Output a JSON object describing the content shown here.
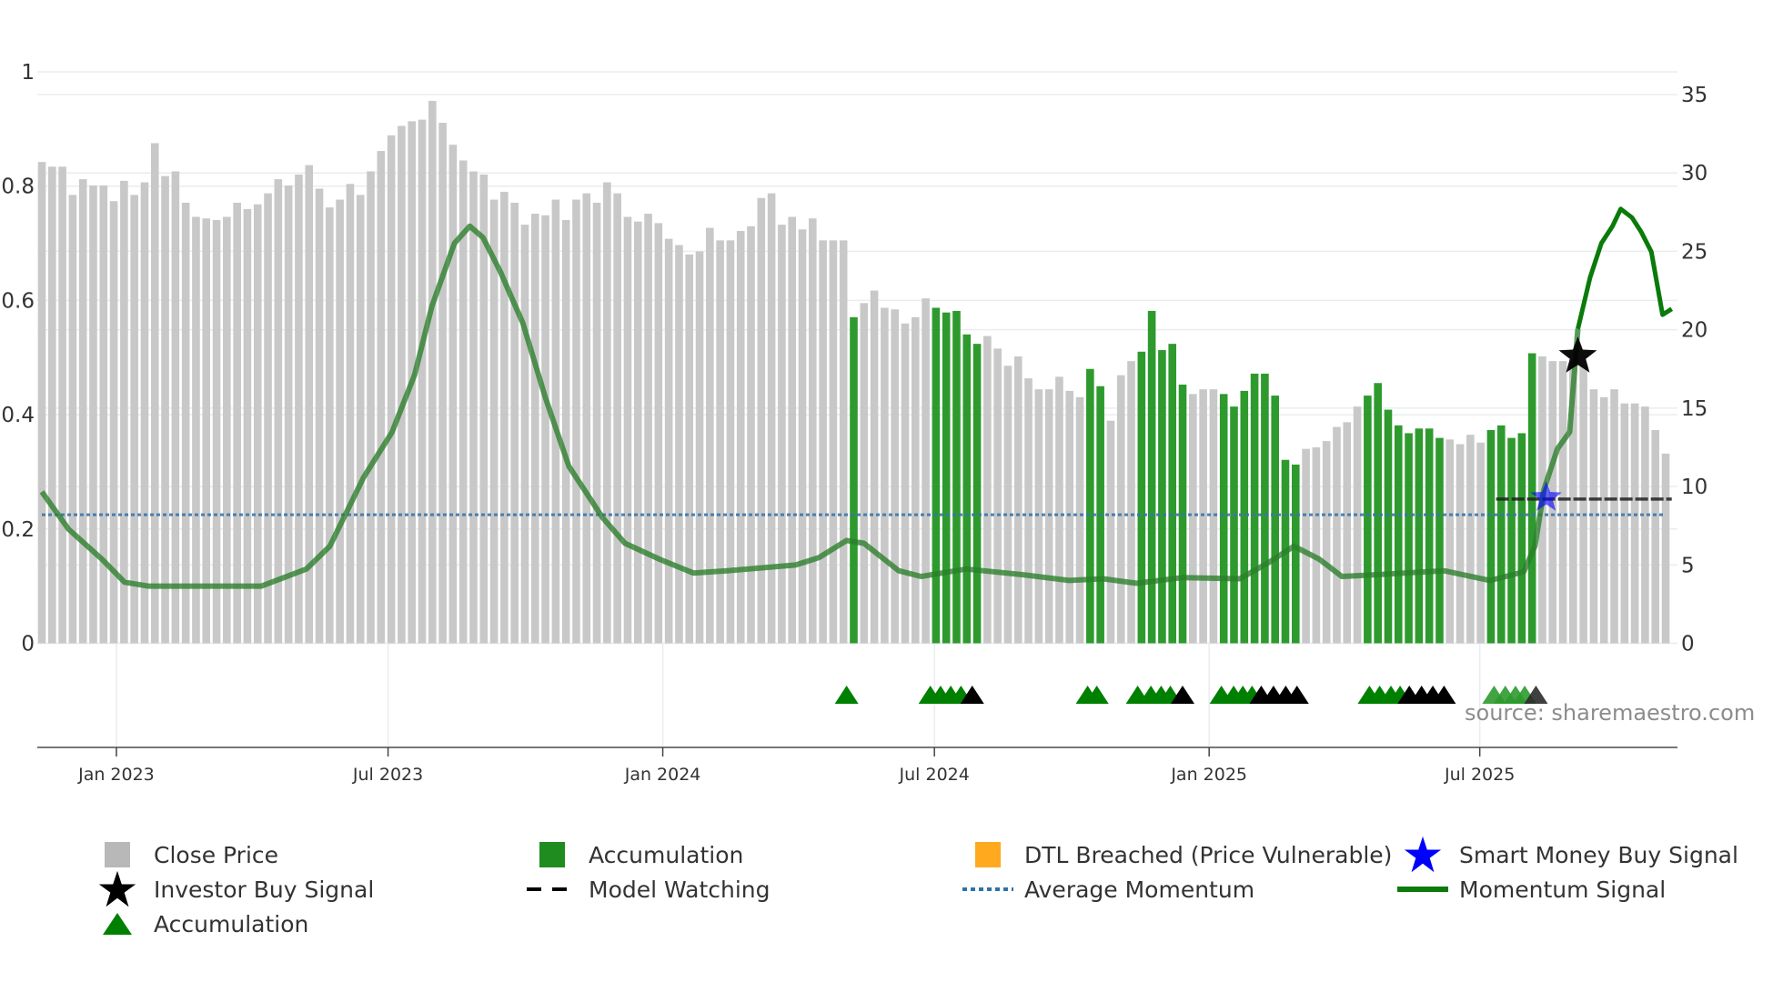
{
  "chart_data": {
    "type": "bar",
    "title": "",
    "source_text": "source: sharemaestro.com",
    "x_domain": [
      0,
      159
    ],
    "x_ticks": [
      {
        "x": 7.3,
        "label": "Jan 2023"
      },
      {
        "x": 33.9,
        "label": "Jul 2023"
      },
      {
        "x": 60.8,
        "label": "Jan 2024"
      },
      {
        "x": 87.4,
        "label": "Jul 2024"
      },
      {
        "x": 114.3,
        "label": "Jan 2025"
      },
      {
        "x": 140.8,
        "label": "Jul 2025"
      }
    ],
    "y_left": {
      "range": [
        0,
        1
      ],
      "ticks": [
        0,
        0.2,
        0.4,
        0.6,
        0.8,
        1
      ],
      "tick_labels": [
        "0",
        "0.2",
        "0.4",
        "0.6",
        "0.8",
        "1"
      ]
    },
    "y_right": {
      "range": [
        0,
        36.45
      ],
      "ticks": [
        0,
        5,
        10,
        15,
        20,
        25,
        30,
        35
      ],
      "tick_labels": [
        "0",
        "5",
        "10",
        "15",
        "20",
        "25",
        "30",
        "35"
      ]
    },
    "close_price": [
      30.7,
      30.4,
      30.4,
      28.6,
      29.6,
      29.2,
      29.2,
      28.2,
      29.5,
      28.6,
      29.4,
      31.9,
      29.8,
      30.1,
      28.1,
      27.2,
      27.1,
      27.0,
      27.2,
      28.1,
      27.7,
      28.0,
      28.7,
      29.6,
      29.2,
      29.9,
      30.5,
      29.0,
      27.8,
      28.3,
      29.3,
      28.6,
      30.1,
      31.4,
      32.4,
      33.0,
      33.3,
      33.4,
      34.6,
      33.2,
      31.8,
      30.8,
      30.1,
      29.9,
      28.3,
      28.8,
      28.1,
      26.7,
      27.4,
      27.3,
      28.3,
      27.0,
      28.3,
      28.7,
      28.1,
      29.4,
      28.7,
      27.2,
      26.9,
      27.4,
      26.8,
      25.8,
      25.4,
      24.8,
      25.0,
      26.5,
      25.7,
      25.7,
      26.3,
      26.6,
      28.4,
      28.7,
      26.7,
      27.2,
      26.4,
      27.1,
      25.7,
      25.7,
      25.7,
      20.8,
      21.7,
      22.5,
      21.4,
      21.3,
      20.4,
      20.8,
      22.0,
      21.4,
      21.1,
      21.2,
      19.7,
      19.1,
      19.6,
      18.8,
      17.7,
      18.3,
      16.9,
      16.2,
      16.2,
      17.0,
      16.1,
      15.7,
      17.5,
      16.4,
      14.2,
      17.1,
      18.0,
      18.6,
      21.2,
      18.7,
      19.1,
      16.5,
      15.9,
      16.2,
      16.2,
      15.9,
      15.1,
      16.1,
      17.2,
      17.2,
      15.8,
      11.7,
      11.4,
      12.4,
      12.5,
      12.9,
      13.8,
      14.1,
      15.1,
      15.8,
      16.6,
      14.9,
      13.9,
      13.4,
      13.7,
      13.7,
      13.1,
      13.0,
      12.7,
      13.3,
      12.8,
      13.6,
      13.9,
      13.1,
      13.4,
      18.5,
      18.3,
      18.0,
      18.0,
      18.0,
      17.7,
      16.2,
      15.7,
      16.2,
      15.3,
      15.3,
      15.1,
      13.6,
      12.1
    ],
    "accumulation_bar_indices": [
      79,
      87,
      88,
      89,
      90,
      91,
      102,
      103,
      107,
      108,
      109,
      110,
      111,
      115,
      116,
      117,
      118,
      119,
      120,
      121,
      122,
      129,
      130,
      131,
      132,
      133,
      134,
      135,
      136,
      141,
      142,
      143,
      144,
      145
    ],
    "momentum_signal": [
      [
        0,
        0.265
      ],
      [
        2.6,
        0.2
      ],
      [
        5.9,
        0.147
      ],
      [
        8.1,
        0.107
      ],
      [
        10.4,
        0.1
      ],
      [
        21.5,
        0.1
      ],
      [
        25.9,
        0.13
      ],
      [
        28.2,
        0.17
      ],
      [
        31.5,
        0.29
      ],
      [
        34.3,
        0.37
      ],
      [
        36.5,
        0.47
      ],
      [
        38.2,
        0.59
      ],
      [
        40.4,
        0.7
      ],
      [
        41.9,
        0.73
      ],
      [
        43.2,
        0.71
      ],
      [
        44.9,
        0.65
      ],
      [
        47.1,
        0.56
      ],
      [
        49.3,
        0.43
      ],
      [
        51.6,
        0.31
      ],
      [
        54.9,
        0.22
      ],
      [
        57.1,
        0.175
      ],
      [
        60.5,
        0.147
      ],
      [
        63.8,
        0.123
      ],
      [
        67.1,
        0.127
      ],
      [
        73.8,
        0.137
      ],
      [
        76.1,
        0.15
      ],
      [
        78.8,
        0.18
      ],
      [
        80.5,
        0.175
      ],
      [
        83.9,
        0.127
      ],
      [
        86.1,
        0.117
      ],
      [
        90.5,
        0.13
      ],
      [
        96.1,
        0.12
      ],
      [
        100.6,
        0.11
      ],
      [
        103.9,
        0.113
      ],
      [
        107.2,
        0.105
      ],
      [
        111.7,
        0.115
      ],
      [
        117.3,
        0.113
      ],
      [
        120,
        0.14
      ],
      [
        122.6,
        0.17
      ],
      [
        125.1,
        0.147
      ],
      [
        127.3,
        0.117
      ],
      [
        130.6,
        0.12
      ],
      [
        137.3,
        0.127
      ],
      [
        141.8,
        0.11
      ],
      [
        145.1,
        0.125
      ],
      [
        146.2,
        0.17
      ],
      [
        147.1,
        0.27
      ],
      [
        148.4,
        0.34
      ],
      [
        149.6,
        0.37
      ],
      [
        150.4,
        0.55
      ]
    ],
    "momentum_signal_recent": [
      [
        150.4,
        0.55
      ],
      [
        151.6,
        0.64
      ],
      [
        152.7,
        0.7
      ],
      [
        153.8,
        0.73
      ],
      [
        154.6,
        0.76
      ],
      [
        155.7,
        0.745
      ],
      [
        156.6,
        0.72
      ],
      [
        157.6,
        0.685
      ],
      [
        158.7,
        0.575
      ],
      [
        159.6,
        0.585
      ]
    ],
    "average_momentum": 0.225,
    "model_watching": {
      "x_start": 142.4,
      "x_end": 159.6,
      "price": 9.2
    },
    "smart_money_buy_signal": {
      "x": 147.3,
      "price": 9.3
    },
    "investor_buy_signal": {
      "x": 150.4,
      "price": 18.3
    },
    "accumulation_markers": [
      {
        "x": 78.8,
        "type": "accumulation"
      },
      {
        "x": 87.0,
        "type": "accumulation"
      },
      {
        "x": 88.0,
        "type": "accumulation"
      },
      {
        "x": 89.0,
        "type": "accumulation"
      },
      {
        "x": 90.0,
        "type": "accumulation"
      },
      {
        "x": 91.1,
        "type": "other"
      },
      {
        "x": 102.4,
        "type": "accumulation"
      },
      {
        "x": 103.3,
        "type": "accumulation"
      },
      {
        "x": 107.3,
        "type": "accumulation"
      },
      {
        "x": 108.6,
        "type": "accumulation"
      },
      {
        "x": 109.6,
        "type": "accumulation"
      },
      {
        "x": 110.5,
        "type": "accumulation"
      },
      {
        "x": 111.7,
        "type": "other"
      },
      {
        "x": 115.5,
        "type": "accumulation"
      },
      {
        "x": 116.7,
        "type": "accumulation"
      },
      {
        "x": 117.6,
        "type": "accumulation"
      },
      {
        "x": 118.5,
        "type": "accumulation"
      },
      {
        "x": 119.4,
        "type": "other"
      },
      {
        "x": 120.6,
        "type": "other"
      },
      {
        "x": 121.8,
        "type": "other"
      },
      {
        "x": 122.9,
        "type": "other"
      },
      {
        "x": 130.0,
        "type": "accumulation"
      },
      {
        "x": 131.0,
        "type": "accumulation"
      },
      {
        "x": 132.1,
        "type": "accumulation"
      },
      {
        "x": 133.0,
        "type": "accumulation"
      },
      {
        "x": 133.9,
        "type": "other"
      },
      {
        "x": 135.1,
        "type": "other"
      },
      {
        "x": 136.2,
        "type": "other"
      },
      {
        "x": 137.3,
        "type": "other"
      },
      {
        "x": 142.2,
        "type": "recent"
      },
      {
        "x": 143.3,
        "type": "recent"
      },
      {
        "x": 144.3,
        "type": "recent"
      },
      {
        "x": 145.2,
        "type": "recent"
      },
      {
        "x": 146.3,
        "type": "recent-other"
      }
    ],
    "colors": {
      "close_price": "#c8c8c8",
      "accumulation": "#2e9a2e",
      "dtl": "#ffa91f",
      "smart_money": "#0000ff",
      "average_momentum": "#3a76a8",
      "momentum": "#0a7a0a",
      "triangle_green": "#008000"
    },
    "legend": {
      "placement": "bottom",
      "items": [
        {
          "label": "Close Price"
        },
        {
          "label": "Accumulation"
        },
        {
          "label": "DTL Breached (Price Vulnerable)"
        },
        {
          "label": "Smart Money Buy Signal"
        },
        {
          "label": "Investor Buy Signal"
        },
        {
          "label": "Model Watching"
        },
        {
          "label": "Average Momentum"
        },
        {
          "label": "Momentum Signal"
        },
        {
          "label": "Accumulation"
        }
      ]
    }
  }
}
